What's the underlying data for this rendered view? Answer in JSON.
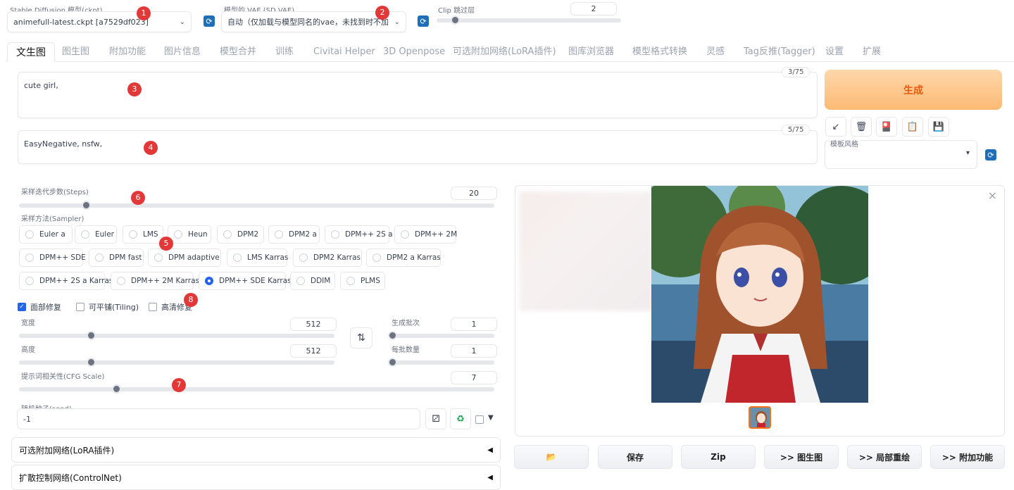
{
  "top": {
    "model_label": "Stable Diffusion 模型(ckpt)",
    "model_value": "animefull-latest.ckpt [a7529df023]",
    "vae_label": "模型的 VAE (SD VAE)",
    "vae_value": "自动（仅加载与模型同名的vae，未找到时不加",
    "clip_label": "Clip 跳过层",
    "clip_value": "2",
    "refresh_glyph": "⟳"
  },
  "tabs": [
    "文生图",
    "图生图",
    "附加功能",
    "图片信息",
    "模型合并",
    "训练",
    "Civitai Helper",
    "3D Openpose",
    "可选附加网络(LoRA插件)",
    "图库浏览器",
    "模型格式转换",
    "灵感",
    "Tag反推(Tagger)",
    "设置",
    "扩展"
  ],
  "prompt": {
    "text": "cute girl,",
    "count": "3/75"
  },
  "negative": {
    "text": "EasyNegative, nsfw,",
    "count": "5/75"
  },
  "generate_label": "生成",
  "tool_icons": [
    "↙",
    "🗑",
    "🎴",
    "📋",
    "💾"
  ],
  "style": {
    "label": "模板风格",
    "chev": "▾"
  },
  "steps": {
    "label": "采样迭代步数(Steps)",
    "value": "20",
    "fraction": 0.135
  },
  "sampler": {
    "label": "采样方法(Sampler)",
    "options": [
      "Euler a",
      "Euler",
      "LMS",
      "Heun",
      "DPM2",
      "DPM2 a",
      "DPM++ 2S a",
      "DPM++ 2M",
      "DPM++ SDE",
      "DPM fast",
      "DPM adaptive",
      "LMS Karras",
      "DPM2 Karras",
      "DPM2 a Karras",
      "DPM++ 2S a Karras",
      "DPM++ 2M Karras",
      "DPM++ SDE Karras",
      "DDIM",
      "PLMS"
    ],
    "selected": "DPM++ SDE Karras"
  },
  "checks": {
    "face": "面部修复",
    "tiling": "可平铺(Tiling)",
    "hires": "高清修复",
    "checkmark": "✓"
  },
  "width": {
    "label": "宽度",
    "value": "512",
    "fraction": 0.22
  },
  "height": {
    "label": "高度",
    "value": "512",
    "fraction": 0.22
  },
  "swap_glyph": "⇅",
  "batch_count": {
    "label": "生成批次",
    "value": "1",
    "fraction": 0
  },
  "batch_size": {
    "label": "每批数量",
    "value": "1",
    "fraction": 0
  },
  "cfg": {
    "label": "提示词相关性(CFG Scale)",
    "value": "7",
    "fraction": 0.2
  },
  "seed": {
    "label": "随机种子(seed)",
    "value": "-1",
    "dice": "⚂",
    "recycle": "♻",
    "arrow": "▼"
  },
  "accordions": [
    {
      "label": "可选附加网络(LoRA插件)",
      "arrow": "◀"
    },
    {
      "label": "扩散控制网络(ControlNet)",
      "arrow": "◀"
    }
  ],
  "gallery_close": "×",
  "output_buttons": {
    "folder": "📂",
    "save": "保存",
    "zip": "Zip",
    "img2img": ">> 图生图",
    "inpaint": ">> 局部重绘",
    "extras": ">> 附加功能"
  },
  "markers": [
    "1",
    "2",
    "3",
    "4",
    "5",
    "6",
    "7",
    "8"
  ],
  "colors": {
    "accent": "#f97316",
    "marker": "#e23838",
    "radio_on": "#2563eb"
  }
}
